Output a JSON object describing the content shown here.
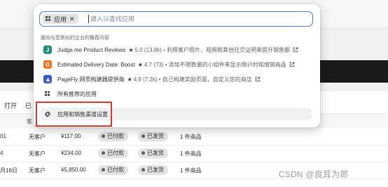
{
  "table": {
    "toolbar": {
      "tab_open": "打开",
      "tab_partial": "已"
    },
    "subheader_fragment": "客",
    "rows": [
      {
        "order_fragment": "01",
        "customer": "无客户",
        "total": "¥117.00",
        "payment": "已付款",
        "fulfillment": "已发货",
        "items": "1 件商品"
      },
      {
        "order_fragment": "4",
        "customer": "无客户",
        "total": "¥234.00",
        "payment": "已付款",
        "fulfillment": "已发货",
        "items": "1 件商品"
      },
      {
        "order_fragment": "月16日",
        "customer": "无客户",
        "total": "¥5,850.00",
        "payment": "已付款",
        "fulfillment": "已发货",
        "items": "1 件商品"
      }
    ]
  },
  "popup": {
    "filter_tag": "应用",
    "search_placeholder": "键入以查找应用",
    "section_title": "面向与您类似的企业的推荐内容",
    "apps": [
      {
        "icon": "judgeme-logo-icon",
        "icon_letter": "J",
        "icon_color": "#1f8f7a",
        "name": "Judge.me Product Reviews",
        "rating": "5.0 (13.8k)",
        "description": "利用客户照片、视频和其他社交证明来提升销售额"
      },
      {
        "icon": "estimated-delivery-logo-icon",
        "icon_letter": "G",
        "icon_color": "#f2711c",
        "name": "Estimated Delivery Date: Boost",
        "rating": "4.7 (73)",
        "description": "添加不限数量的小组件来显示倒计时和增销商品"
      },
      {
        "icon": "pagefly-logo-icon",
        "icon_letter": "",
        "icon_color": "#3b5bdb",
        "name": "PageFly 网页构建器提供商",
        "rating": "4.9 (7.2k)",
        "description": "自己构建奖励页面，自定义您的商店"
      }
    ],
    "all_apps_label": "所有推荐的应用",
    "settings_label": "应用和销售渠道设置"
  },
  "watermark": "CSDN @良耳为郎"
}
